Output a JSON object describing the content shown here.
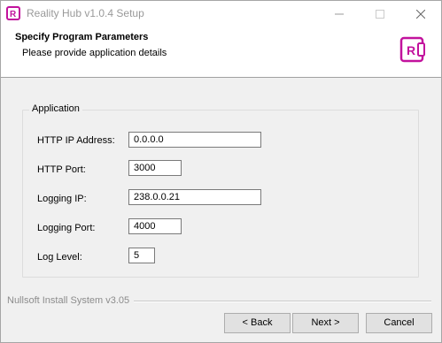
{
  "window": {
    "title": "Reality Hub v1.0.4 Setup",
    "icon_letter": "R",
    "controls": [
      "minimize-icon",
      "maximize-icon",
      "close-icon"
    ]
  },
  "header": {
    "title": "Specify Program Parameters",
    "subtitle": "Please provide application details",
    "logo_letter": "R",
    "accent_color": "#c2129d"
  },
  "group": {
    "label": "Application",
    "fields": [
      {
        "label": "HTTP IP Address:",
        "value": "0.0.0.0"
      },
      {
        "label": "HTTP Port:",
        "value": "3000"
      },
      {
        "label": "Logging IP:",
        "value": "238.0.0.21"
      },
      {
        "label": "Logging Port:",
        "value": "4000"
      },
      {
        "label": "Log Level:",
        "value": "5"
      }
    ]
  },
  "footer": {
    "brand": "Nullsoft Install System v3.05",
    "back_label": "< Back",
    "next_label": "Next >",
    "cancel_label": "Cancel"
  }
}
